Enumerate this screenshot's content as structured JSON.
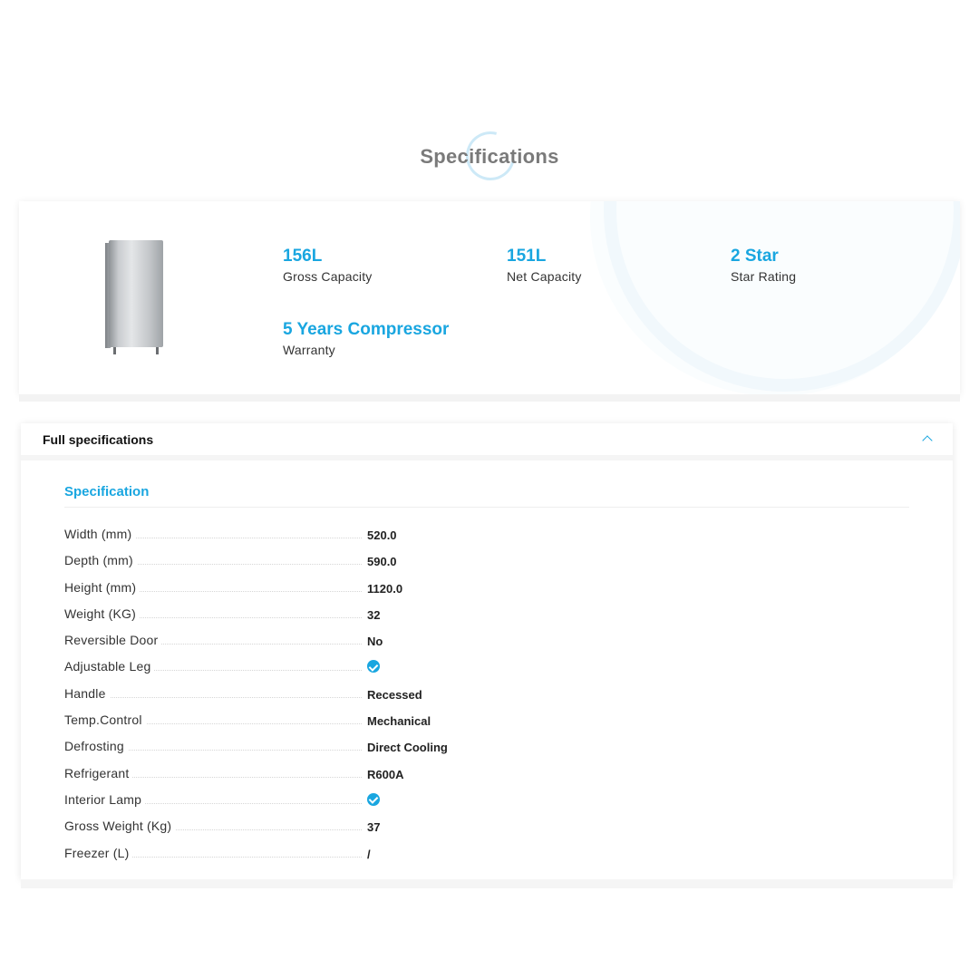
{
  "heading": "Specifications",
  "summary": {
    "image_alt": "refrigerator",
    "stats": [
      {
        "value": "156L",
        "label": "Gross Capacity"
      },
      {
        "value": "151L",
        "label": "Net Capacity"
      },
      {
        "value": "2 Star",
        "label": "Star Rating"
      },
      {
        "value": "5 Years Compressor",
        "label": "Warranty"
      }
    ]
  },
  "full_specs": {
    "title": "Full specifications",
    "toggle_icon": "chevron-up-icon",
    "section_title": "Specification",
    "rows": [
      {
        "label": "Width (mm)",
        "value": "520.0"
      },
      {
        "label": "Depth (mm)",
        "value": "590.0"
      },
      {
        "label": "Height (mm)",
        "value": "1120.0"
      },
      {
        "label": "Weight (KG)",
        "value": "32"
      },
      {
        "label": "Reversible Door",
        "value": "No"
      },
      {
        "label": "Adjustable Leg",
        "value": "",
        "icon": "check-icon"
      },
      {
        "label": "Handle",
        "value": "Recessed"
      },
      {
        "label": "Temp.Control",
        "value": "Mechanical"
      },
      {
        "label": "Defrosting",
        "value": "Direct Cooling"
      },
      {
        "label": "Refrigerant",
        "value": "R600A"
      },
      {
        "label": "Interior Lamp",
        "value": "",
        "icon": "check-icon"
      },
      {
        "label": "Gross Weight (Kg)",
        "value": "37"
      },
      {
        "label": "Freezer (L)",
        "value": "/"
      }
    ]
  },
  "colors": {
    "accent": "#19a6e0",
    "heading": "#7a7a7a"
  }
}
